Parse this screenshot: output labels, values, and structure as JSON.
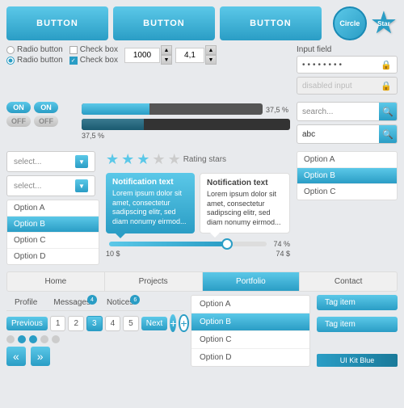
{
  "buttons": {
    "btn1": "BUTTON",
    "btn2": "BUTTON",
    "btn3": "BUTTON"
  },
  "radio": {
    "label1": "Radio button",
    "label2": "Radio button"
  },
  "checkbox": {
    "label1": "Check box",
    "label2": "Check box"
  },
  "number_inputs": {
    "val1": "1000",
    "val2": "4,1"
  },
  "toggles": {
    "on": "ON",
    "off": "OFF"
  },
  "progress": {
    "val1": "37,5 %",
    "val2": "37,5 %",
    "pct1": 37.5,
    "pct2": 30
  },
  "selects": {
    "placeholder1": "select...",
    "placeholder2": "select..."
  },
  "options_left": {
    "items": [
      "Option A",
      "Option B",
      "Option C",
      "Option D"
    ],
    "active": 1
  },
  "stars": {
    "count": 3,
    "total": 5,
    "label": "Rating stars"
  },
  "notifications": {
    "title1": "Notification text",
    "text1": "Lorem ipsum dolor sit amet, consectetur sadipscing elitr, sed diam nonumy eirmod...",
    "title2": "Notification text",
    "text2": "Lorem ipsum dolor sit amet, consectetur sadipscing elitr, sed diam nonumy eirmod..."
  },
  "slider": {
    "min": "10 $",
    "max": "74 $",
    "pct": 74,
    "label": "74 %"
  },
  "input_right": {
    "label": "Input field",
    "password": "••••••••",
    "disabled": "disabled input",
    "search_placeholder": "search...",
    "search_val": "abc"
  },
  "circle_star": {
    "circle_label": "Circle",
    "star_label": "Star"
  },
  "options_right": {
    "items": [
      "Option A",
      "Option B",
      "Option C"
    ],
    "active": 1
  },
  "nav": {
    "items": [
      "Home",
      "Projects",
      "Portfolio",
      "Contact"
    ],
    "active": 2
  },
  "tabs": {
    "items": [
      "Profile",
      "Messages",
      "Notices"
    ],
    "badges": [
      "",
      "4",
      "6"
    ]
  },
  "pagination": {
    "prev": "Previous",
    "next": "Next",
    "pages": [
      "1",
      "2",
      "3",
      "4",
      "5"
    ],
    "active": 2
  },
  "bottom_options": {
    "items": [
      "Option A",
      "Option B",
      "Option C",
      "Option D"
    ],
    "active": 1
  },
  "tags": {
    "items": [
      "Tag item",
      "Tag item"
    ]
  },
  "watermark": "UI Kit Blue"
}
